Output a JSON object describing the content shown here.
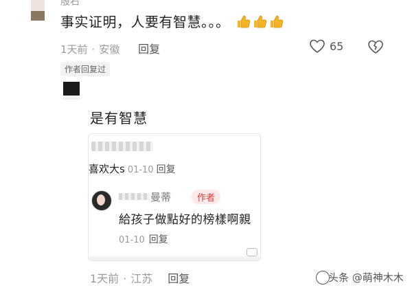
{
  "top_comment": {
    "username": "殷石",
    "text": "事实证明，人要有智慧。。。",
    "emojis": [
      "thumbs-up-icon",
      "thumbs-up-icon",
      "thumbs-up-icon"
    ],
    "time": "1天前",
    "location": "安徽",
    "reply_label": "回复",
    "like_count": "65",
    "author_replied_tag": "作者回复过"
  },
  "author_reply": {
    "text": "是有智慧"
  },
  "quoted_card": {
    "line1_text": "喜欢大s",
    "line1_date": "01-10",
    "line1_reply": "回复",
    "reply_name": "曼蒂",
    "author_badge": "作者",
    "reply_text": "給孩子做點好的榜樣啊親",
    "reply_date": "01-10",
    "reply_reply": "回复"
  },
  "bottom_meta": {
    "time": "1天前",
    "location": "江苏",
    "reply_label": "回复"
  },
  "watermark": "头条 @萌神木木",
  "colors": {
    "text": "#222222",
    "muted": "#9a9a9a",
    "author_badge_red": "#d33a3a",
    "thumbs_yellow": "#f6b324"
  }
}
